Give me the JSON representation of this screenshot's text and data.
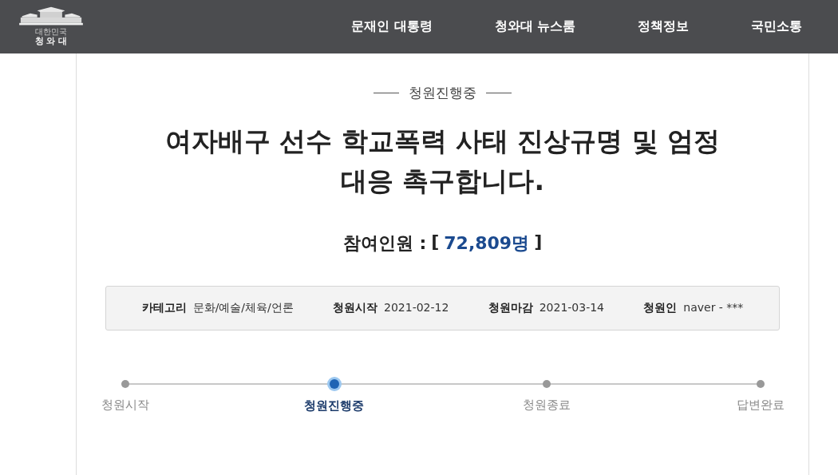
{
  "header": {
    "logo": {
      "small": "대한민국",
      "name": "청 와 대"
    },
    "nav": [
      {
        "label": "문재인 대통령"
      },
      {
        "label": "청와대 뉴스룸"
      },
      {
        "label": "정책정보"
      },
      {
        "label": "국민소통"
      }
    ]
  },
  "petition": {
    "status": "청원진행중",
    "title": "여자배구 선수 학교폭력 사태 진상규명 및 엄정 대응 촉구합니다.",
    "participants_label": "참여인원 :",
    "bracket_open": "[",
    "count": "72,809명",
    "bracket_close": "]",
    "info": [
      {
        "label": "카테고리",
        "value": "문화/예술/체육/언론"
      },
      {
        "label": "청원시작",
        "value": "2021-02-12"
      },
      {
        "label": "청원마감",
        "value": "2021-03-14"
      },
      {
        "label": "청원인",
        "value": "naver - ***"
      }
    ],
    "steps": [
      {
        "label": "청원시작",
        "selected": false
      },
      {
        "label": "청원진행중",
        "selected": true
      },
      {
        "label": "청원종료",
        "selected": false
      },
      {
        "label": "답변완료",
        "selected": false
      }
    ]
  }
}
